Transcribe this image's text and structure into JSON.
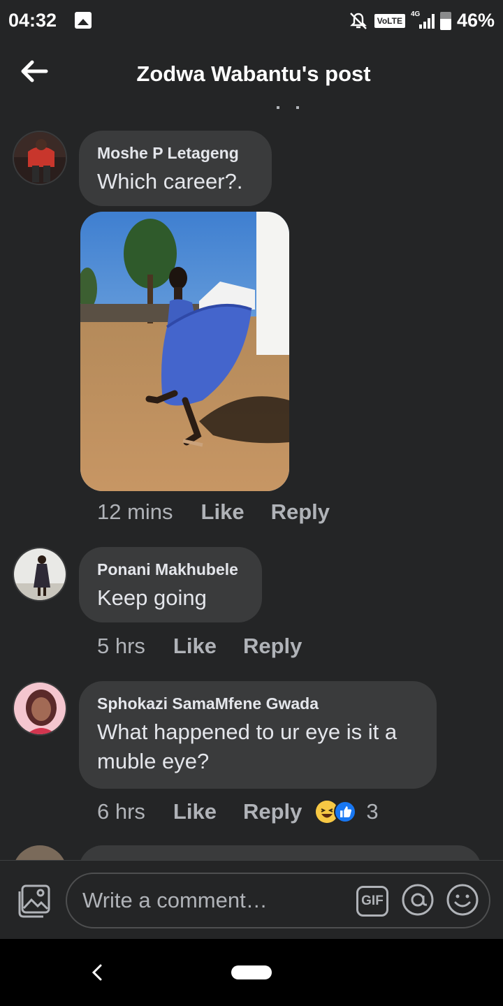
{
  "status_bar": {
    "time": "04:32",
    "network_label": "VoLTE",
    "network_type": "4G",
    "battery": "46%",
    "icons": [
      "gallery-icon",
      "mute-icon",
      "signal-icon",
      "battery-icon"
    ]
  },
  "header": {
    "title": "Zodwa Wabantu's post",
    "back_icon": "arrow-left-icon"
  },
  "comments": [
    {
      "author": "Moshe P Letageng",
      "text": "Which career?.",
      "time": "12 mins",
      "like_label": "Like",
      "reply_label": "Reply",
      "has_photo": true
    },
    {
      "author": "Ponani Makhubele",
      "text": "Keep going",
      "time": "5 hrs",
      "like_label": "Like",
      "reply_label": "Reply"
    },
    {
      "author": "Sphokazi SamaMfene Gwada",
      "text": "What happened to ur eye is it a muble eye?",
      "time": "6 hrs",
      "like_label": "Like",
      "reply_label": "Reply",
      "reactions": {
        "types": [
          "haha",
          "like"
        ],
        "count": "3"
      }
    }
  ],
  "composer": {
    "placeholder": "Write a comment…",
    "gif_label": "GIF",
    "icons": [
      "photo-icon",
      "gif-icon",
      "mention-icon",
      "emoji-icon"
    ]
  },
  "colors": {
    "background": "#242526",
    "bubble": "#3a3b3c",
    "primary_text": "#e4e6eb",
    "secondary_text": "#b0b3b8",
    "like_blue": "#1877f2"
  }
}
